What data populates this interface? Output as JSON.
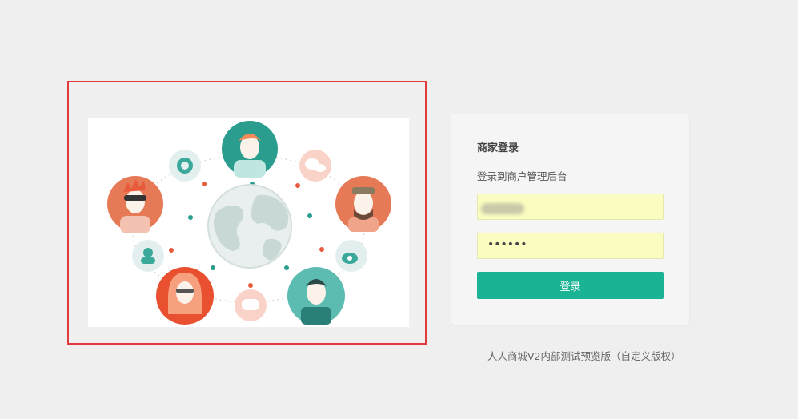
{
  "login": {
    "title": "商家登录",
    "subtitle": "登录到商户管理后台",
    "password_value": "••••••",
    "submit_label": "登录"
  },
  "footer": {
    "copyright": "人人商城V2内部测试预览版（自定义版权）"
  },
  "colors": {
    "accent": "#1ab394",
    "field_bg": "#fbfcc0",
    "frame_border": "#e03a3a"
  }
}
